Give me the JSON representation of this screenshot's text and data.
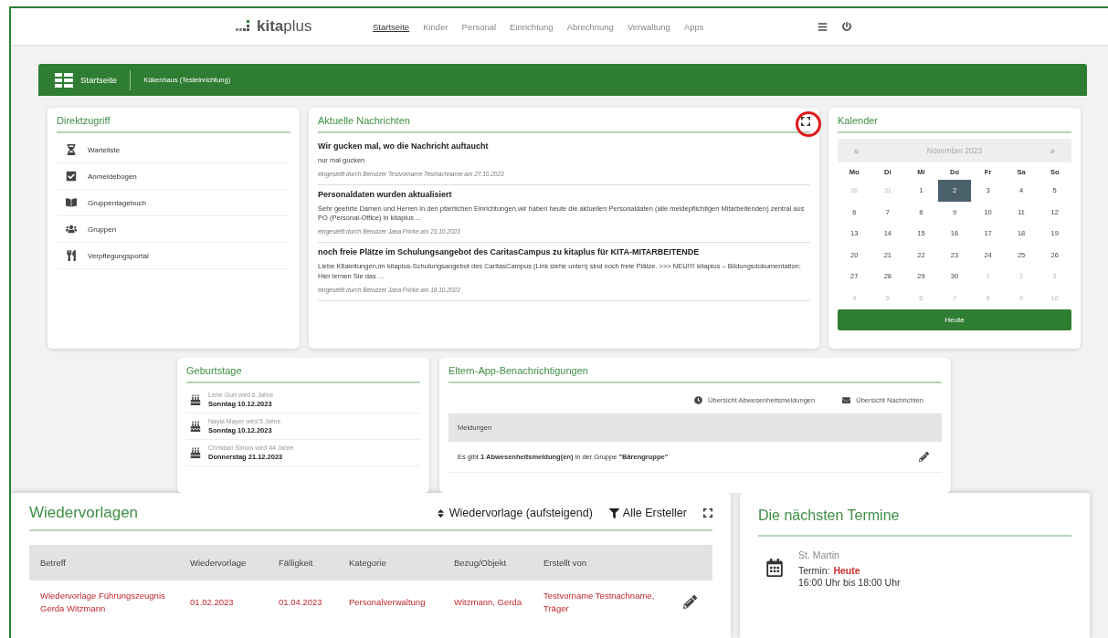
{
  "header": {
    "logo": "**kita**plus",
    "nav": [
      {
        "label": "Startseite",
        "selected": true
      },
      {
        "label": "Kinder",
        "selected": false
      },
      {
        "label": "Personal",
        "selected": false
      },
      {
        "label": "Einrichtung",
        "selected": false
      },
      {
        "label": "Abrechnung",
        "selected": false
      },
      {
        "label": "Verwaltung",
        "selected": false
      },
      {
        "label": "Apps",
        "selected": false
      }
    ]
  },
  "breadcrumb": {
    "page": "Startseite",
    "facility": "Kükenhaus (Testeinrichtung)"
  },
  "direktzugriff": {
    "title": "Direktzugriff",
    "items": [
      "Warteliste",
      "Anmeldebogen",
      "Gruppentagebuch",
      "Gruppen",
      "Verpflegungsportal"
    ]
  },
  "nachrichten": {
    "title": "Aktuelle Nachrichten",
    "items": [
      {
        "title": "Wir gucken mal, wo die Nachricht auftaucht",
        "body": "nur mal gucken",
        "meta": "eingestellt durch Benutzer Testvorname Testnachname am 27.10.2023"
      },
      {
        "title": "Personaldaten wurden aktualisiert",
        "body": "Sehr geehrte Damen und Herren in den pfarrlichen Einrichtungen,wir haben heute die aktuellen Personaldaten (alle meldepflichtigen Mitarbeitenden) zentral aus PO (Personal-Office) in kitaplus ...",
        "meta": "eingestellt durch Benutzer Jana Fricke am 23.10.2023"
      },
      {
        "title": "noch freie Plätze im Schulungsangebot des CaritasCampus zu kitaplus für KITA-MITARBEITENDE",
        "body": "Liebe Kitaleitungen,im kitaplus-Schulungsangebot des CaritasCampus (Link siehe unten) sind noch freie Plätze. >>> NEU!!!! kitaplus – Bildungsdokumentation: Hier lernen Sie das ...",
        "meta": "eingestellt durch Benutzer Jana Fricke am 18.10.2023"
      }
    ]
  },
  "kalender": {
    "title": "Kalender",
    "prev": "«",
    "month": "November 2023",
    "next": "»",
    "weekdays": [
      "Mo",
      "Di",
      "Mi",
      "Do",
      "Fr",
      "Sa",
      "So"
    ],
    "weeks": [
      [
        {
          "day": "30",
          "muted": true,
          "selected": false
        },
        {
          "day": "31",
          "muted": true,
          "selected": false
        },
        {
          "day": "1",
          "muted": false,
          "selected": false
        },
        {
          "day": "2",
          "muted": false,
          "selected": true
        },
        {
          "day": "3",
          "muted": false,
          "selected": false
        },
        {
          "day": "4",
          "muted": false,
          "selected": false
        },
        {
          "day": "5",
          "muted": false,
          "selected": false
        }
      ],
      [
        {
          "day": "6",
          "muted": false,
          "selected": false
        },
        {
          "day": "7",
          "muted": false,
          "selected": false
        },
        {
          "day": "8",
          "muted": false,
          "selected": false
        },
        {
          "day": "9",
          "muted": false,
          "selected": false
        },
        {
          "day": "10",
          "muted": false,
          "selected": false
        },
        {
          "day": "11",
          "muted": false,
          "selected": false
        },
        {
          "day": "12",
          "muted": false,
          "selected": false
        }
      ],
      [
        {
          "day": "13",
          "muted": false,
          "selected": false
        },
        {
          "day": "14",
          "muted": false,
          "selected": false
        },
        {
          "day": "15",
          "muted": false,
          "selected": false
        },
        {
          "day": "16",
          "muted": false,
          "selected": false
        },
        {
          "day": "17",
          "muted": false,
          "selected": false
        },
        {
          "day": "18",
          "muted": false,
          "selected": false
        },
        {
          "day": "19",
          "muted": false,
          "selected": false
        }
      ],
      [
        {
          "day": "20",
          "muted": false,
          "selected": false
        },
        {
          "day": "21",
          "muted": false,
          "selected": false
        },
        {
          "day": "22",
          "muted": false,
          "selected": false
        },
        {
          "day": "23",
          "muted": false,
          "selected": false
        },
        {
          "day": "24",
          "muted": false,
          "selected": false
        },
        {
          "day": "25",
          "muted": false,
          "selected": false
        },
        {
          "day": "26",
          "muted": false,
          "selected": false
        }
      ],
      [
        {
          "day": "27",
          "muted": false,
          "selected": false
        },
        {
          "day": "28",
          "muted": false,
          "selected": false
        },
        {
          "day": "29",
          "muted": false,
          "selected": false
        },
        {
          "day": "30",
          "muted": false,
          "selected": false
        },
        {
          "day": "1",
          "muted": true,
          "selected": false
        },
        {
          "day": "2",
          "muted": true,
          "selected": false
        },
        {
          "day": "3",
          "muted": true,
          "selected": false
        }
      ],
      [
        {
          "day": "4",
          "muted": true,
          "selected": false
        },
        {
          "day": "5",
          "muted": true,
          "selected": false
        },
        {
          "day": "6",
          "muted": true,
          "selected": false
        },
        {
          "day": "7",
          "muted": true,
          "selected": false
        },
        {
          "day": "8",
          "muted": true,
          "selected": false
        },
        {
          "day": "9",
          "muted": true,
          "selected": false
        },
        {
          "day": "10",
          "muted": true,
          "selected": false
        }
      ]
    ],
    "today_button": "Heute"
  },
  "geburtstage": {
    "title": "Geburtstage",
    "items": [
      {
        "name": "Lene Gurt wird 6 Jahre",
        "date": "Sonntag 10.12.2023"
      },
      {
        "name": "Nayla Mayer wird 5 Jahre",
        "date": "Sonntag 10.12.2023"
      },
      {
        "name": "Christian Simon wird 44 Jahre",
        "date": "Donnerstag 21.12.2023"
      }
    ]
  },
  "eltern_app": {
    "title": "Eltern-App-Benachrichtigungen",
    "links": [
      "Übersicht Abwesenheitsmeldungen",
      "Übersicht Nachrichten"
    ],
    "table_header": "Meldungen",
    "rows": [
      "Es gibt **1 Abwesenheitsmeldung(en)** in der Gruppe **\"Bärengruppe\"**"
    ]
  },
  "wiedervorlagen": {
    "title": "Wiedervorlagen",
    "sort": "Wiedervorlage (aufsteigend)",
    "filter": "Alle Ersteller",
    "columns": [
      "Betreff",
      "Wiedervorlage",
      "Fälligkeit",
      "Kategorie",
      "Bezug/Objekt",
      "Erstellt von"
    ],
    "rows": [
      [
        "Wiedervorlage Führungszeugnis Gerda Witzmann",
        "01.02.2023",
        "01.04.2023",
        "Personalverwaltung",
        "Witzmann, Gerda",
        "Testvorname Testnachname, Träger"
      ]
    ]
  },
  "termine": {
    "title": "Die nächsten Termine",
    "items": [
      {
        "name": "St. Martin",
        "label": "Termin:",
        "when": "Heute",
        "time": "16:00 Uhr bis 18:00 Uhr"
      }
    ]
  }
}
